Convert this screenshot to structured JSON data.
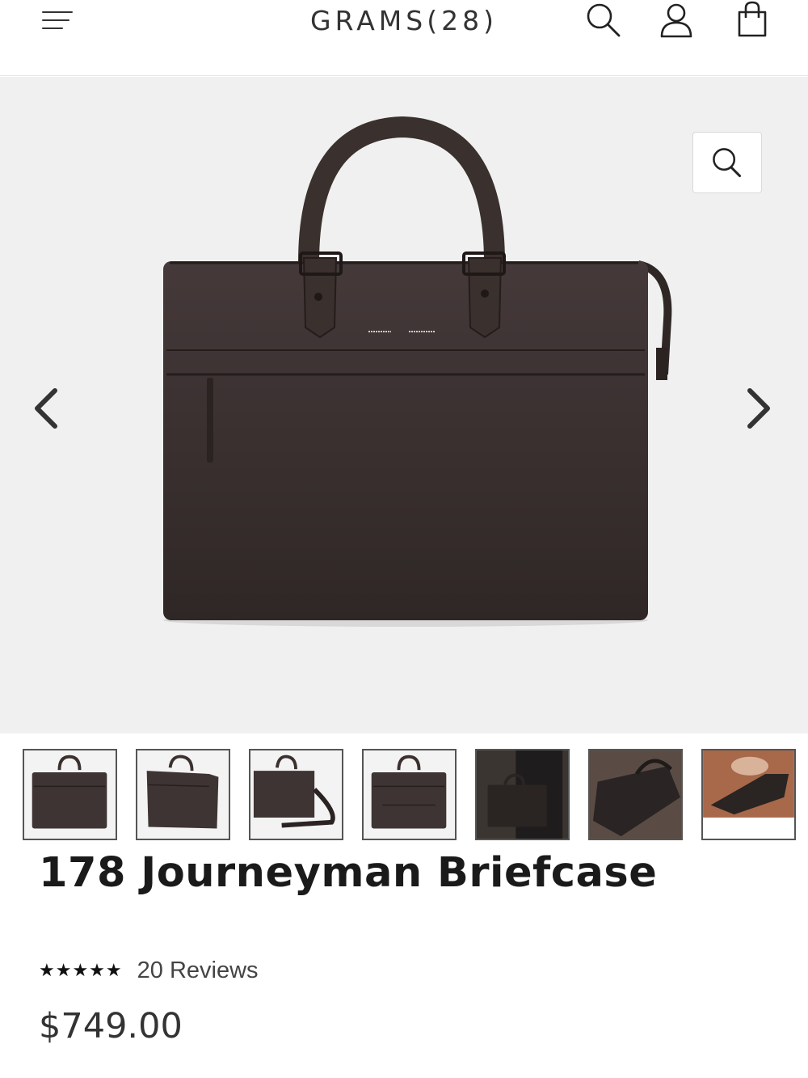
{
  "header": {
    "brand": "GRAMS(28)",
    "menu_icon": "hamburger-menu-icon",
    "search_icon": "search-icon",
    "account_icon": "user-account-icon",
    "cart_icon": "shopping-bag-icon"
  },
  "hero": {
    "product_image": "briefcase-front-view",
    "zoom_icon": "magnifier-zoom-icon",
    "prev_icon": "chevron-left-icon",
    "next_icon": "chevron-right-icon",
    "bag_color": "#3a302d",
    "background_color": "#f0f0f0"
  },
  "thumbnails": [
    {
      "name": "front-view"
    },
    {
      "name": "angled-view"
    },
    {
      "name": "with-shoulder-strap"
    },
    {
      "name": "back-view"
    },
    {
      "name": "carried-by-model"
    },
    {
      "name": "top-detail"
    },
    {
      "name": "interior-view"
    }
  ],
  "product": {
    "title": "178 Journeyman Briefcase",
    "stars": "★★★★★",
    "rating_value": 5,
    "reviews_label": "20 Reviews",
    "price": "$749.00"
  }
}
